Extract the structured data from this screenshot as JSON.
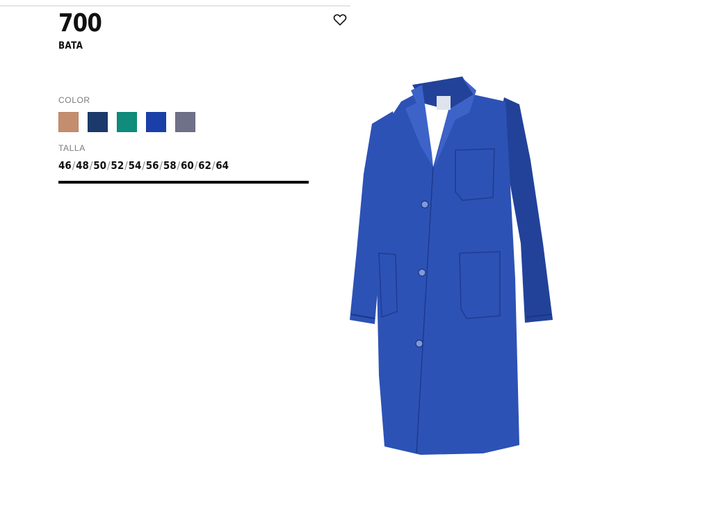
{
  "product": {
    "code": "700",
    "name": "BATA"
  },
  "favorite_icon": "heart-outline-icon",
  "color_section": {
    "label": "COLOR",
    "swatches": [
      {
        "name": "beige",
        "hex": "#C48E6E"
      },
      {
        "name": "navy",
        "hex": "#1B3A6B"
      },
      {
        "name": "green",
        "hex": "#0F8C7B"
      },
      {
        "name": "royal-blue",
        "hex": "#1A3FA8"
      },
      {
        "name": "grey",
        "hex": "#6E7188"
      }
    ]
  },
  "size_section": {
    "label": "TALLA",
    "sizes": [
      "46",
      "48",
      "50",
      "52",
      "54",
      "56",
      "58",
      "60",
      "62",
      "64"
    ],
    "separator": "/"
  },
  "image": {
    "subject": "royal-blue work coat",
    "main_color": "#2D52B5",
    "shade_color": "#22429A",
    "highlight_color": "#3D63C8"
  }
}
